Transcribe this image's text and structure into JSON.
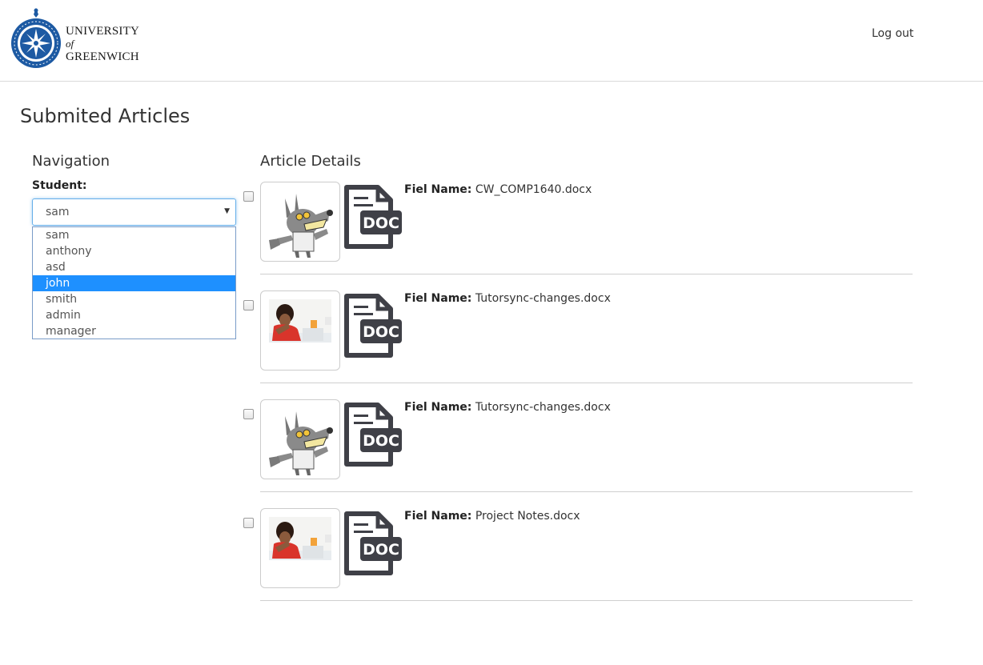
{
  "header": {
    "logo": {
      "line1": "UNIVERSITY",
      "line2": "of",
      "line3": "GREENWICH"
    },
    "logout_label": "Log out"
  },
  "page_title": "Submited Articles",
  "navigation": {
    "heading": "Navigation",
    "student_label": "Student:",
    "selected_value": "sam",
    "options": [
      "sam",
      "anthony",
      "asd",
      "john",
      "smith",
      "admin",
      "manager"
    ],
    "highlighted_option": "john"
  },
  "articles": {
    "heading": "Article Details",
    "file_name_label": "Fiel Name:",
    "doc_icon_text": "DOC",
    "items": [
      {
        "file_name": "CW_COMP1640.docx",
        "thumbnail": "wolf-cartoon-image"
      },
      {
        "file_name": "Tutorsync-changes.docx",
        "thumbnail": "student-photo-image"
      },
      {
        "file_name": "Tutorsync-changes.docx",
        "thumbnail": "wolf-cartoon-image"
      },
      {
        "file_name": "Project Notes.docx",
        "thumbnail": "student-photo-image"
      }
    ]
  },
  "colors": {
    "seal_blue": "#1d5aa3",
    "selected_option": "#1e90ff",
    "doc_icon": "#3f4047"
  }
}
